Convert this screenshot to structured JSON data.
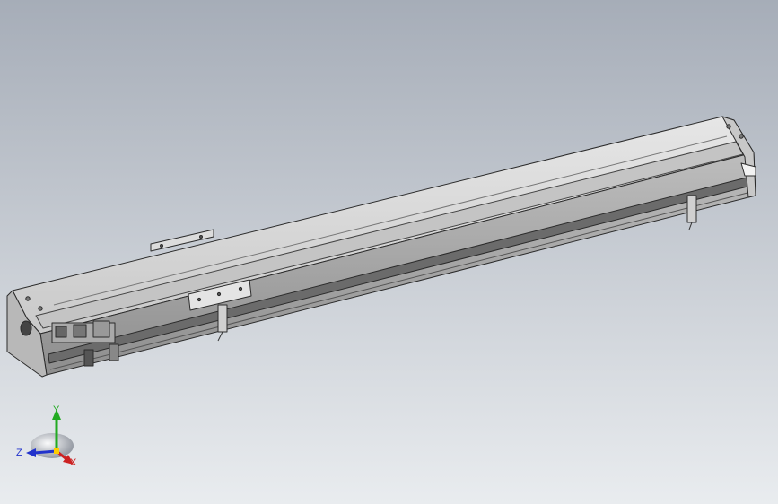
{
  "viewport": {
    "background_top": "#a6adb8",
    "background_bottom": "#e9ecef"
  },
  "model": {
    "name": "linear-module",
    "body_color": "#d8d8d8",
    "edge_color": "#2b2b2b",
    "shadow_color": "#9a9a9a"
  },
  "triad": {
    "y_label": "Y",
    "z_label": "Z",
    "x_label": "X",
    "y_color": "#22aa22",
    "z_color": "#2233cc",
    "x_color": "#cc2222"
  }
}
